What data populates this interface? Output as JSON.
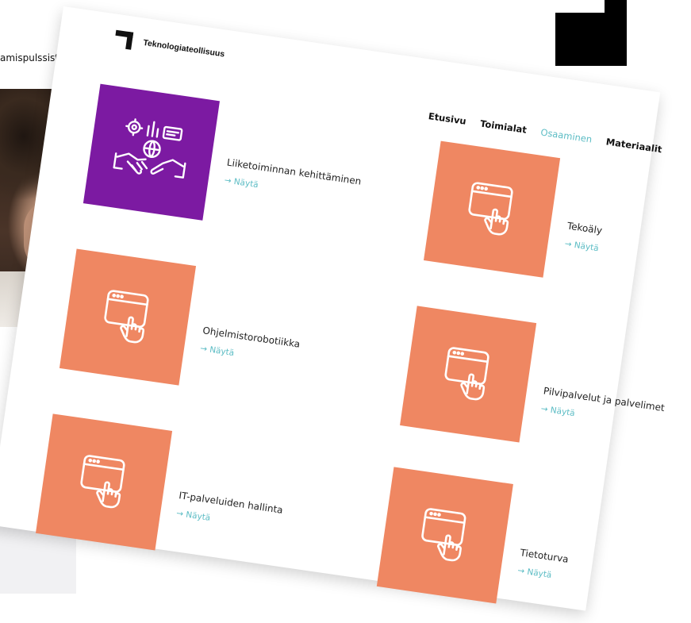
{
  "background": {
    "snippet_text": "amispulssista"
  },
  "header": {
    "logo_text": "Teknologiateollisuus"
  },
  "nav": {
    "items": [
      {
        "label": "Etusivu",
        "active": false
      },
      {
        "label": "Toimialat",
        "active": false
      },
      {
        "label": "Osaaminen",
        "active": true
      },
      {
        "label": "Materiaalit",
        "active": false
      }
    ]
  },
  "colors": {
    "accent": "#5bbcc4",
    "tile_orange": "#ef8762",
    "tile_purple": "#7c1aa2"
  },
  "items": [
    {
      "title": "Liiketoiminnan kehittäminen",
      "link": "→ Näytä",
      "icon": "business-handshake-icon"
    },
    {
      "title": "Tekoäly",
      "link": "→ Näytä",
      "icon": "browser-click-icon"
    },
    {
      "title": "Ohjelmistorobotiikka",
      "link": "→ Näytä",
      "icon": "browser-click-icon"
    },
    {
      "title": "Pilvipalvelut ja palvelimet",
      "link": "→ Näytä",
      "icon": "browser-click-icon"
    },
    {
      "title": "IT-palveluiden hallinta",
      "link": "→ Näytä",
      "icon": "browser-click-icon"
    },
    {
      "title": "Tietoturva",
      "link": "→ Näytä",
      "icon": "browser-click-icon"
    }
  ]
}
